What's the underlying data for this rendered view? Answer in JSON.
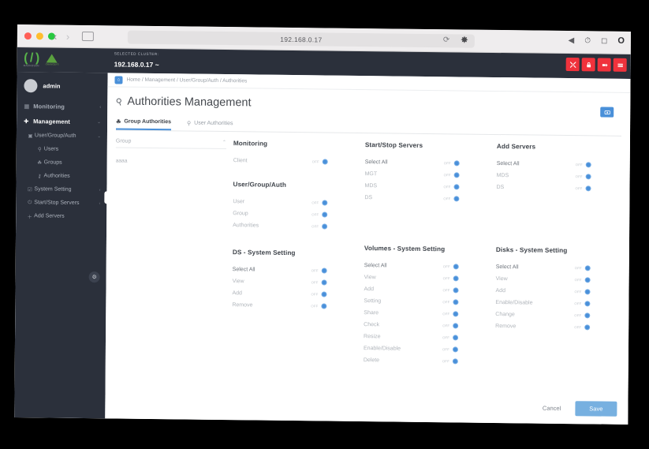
{
  "browser": {
    "url": "192.168.0.17",
    "back_icon": "chevron-left-icon",
    "forward_icon": "chevron-right-icon",
    "sidebar_icon": "sidebar-icon",
    "reload_icon": "reload-icon",
    "share_icon": "share-icon",
    "right_icons": [
      "volume-icon",
      "battery-icon",
      "control-center-icon",
      "clock-icon"
    ]
  },
  "topbar": {
    "cluster_label": "SELECTED CLUSTER:",
    "cluster_value": "192.168.0.17 ~",
    "logo_primary": "( / )",
    "logo_primary_sub": "MACROSAN",
    "logo_secondary_sub": "ORANGEFS",
    "actions": [
      {
        "name": "fullscreen-button",
        "icon": "expand-icon"
      },
      {
        "name": "lock-button",
        "icon": "lock-icon"
      },
      {
        "name": "logout-button",
        "icon": "logout-icon"
      },
      {
        "name": "menu-button",
        "icon": "hamburger-icon"
      }
    ],
    "action_color": "#f0323c"
  },
  "sidebar": {
    "user": "admin",
    "avatar": "avatar-icon",
    "collapse_icon": "chevron-left-icon",
    "items": [
      {
        "label": "Monitoring",
        "icon": "chart-icon",
        "level": 0,
        "active": false,
        "caret": "‹"
      },
      {
        "label": "Management",
        "icon": "wrench-icon",
        "level": 0,
        "active": true,
        "caret": "⌄"
      },
      {
        "label": "User/Group/Auth",
        "icon": "▣",
        "level": 1,
        "active": false,
        "caret": "⌄"
      },
      {
        "label": "Users",
        "icon": "⚲",
        "level": 2,
        "active": false,
        "caret": ""
      },
      {
        "label": "Groups",
        "icon": "☘",
        "level": 2,
        "active": false,
        "caret": ""
      },
      {
        "label": "Authorities",
        "icon": "⚷",
        "level": 2,
        "active": false,
        "caret": ""
      },
      {
        "label": "System Setting",
        "icon": "☑",
        "level": 1,
        "active": false,
        "caret": "‹"
      },
      {
        "label": "Start/Stop Servers",
        "icon": "⏻",
        "level": 1,
        "active": false,
        "caret": "‹"
      },
      {
        "label": "Add Servers",
        "icon": "＋",
        "level": 1,
        "active": false,
        "caret": ""
      }
    ]
  },
  "breadcrumb": {
    "home_icon": "home-icon",
    "text": "Home / Management / User/Group/Auth / Authorities"
  },
  "page": {
    "title": "Authorities Management",
    "title_icon": "key-icon",
    "refresh_icon": "refresh-icon"
  },
  "tabs": [
    {
      "label": "Group Authorities",
      "icon": "☘",
      "active": true
    },
    {
      "label": "User Authorities",
      "icon": "⚲",
      "active": false
    }
  ],
  "group_panel": {
    "select_label": "Group",
    "caret": "⌃",
    "groups": [
      "aaaa"
    ]
  },
  "toggle_state_label": "OFF",
  "permission_blocks": [
    {
      "title": "Monitoring",
      "column": 0,
      "rows": [
        {
          "label": "Client",
          "state": "OFF",
          "strong": false
        }
      ]
    },
    {
      "title": "User/Group/Auth",
      "column": 0,
      "rows": [
        {
          "label": "User",
          "state": "OFF",
          "strong": false
        },
        {
          "label": "Group",
          "state": "OFF",
          "strong": false
        },
        {
          "label": "Authorities",
          "state": "OFF",
          "strong": false
        }
      ]
    },
    {
      "title": "Start/Stop Servers",
      "column": 1,
      "rows": [
        {
          "label": "Select All",
          "state": "OFF",
          "strong": true
        },
        {
          "label": "MGT",
          "state": "OFF",
          "strong": false
        },
        {
          "label": "MDS",
          "state": "OFF",
          "strong": false
        },
        {
          "label": "DS",
          "state": "OFF",
          "strong": false
        }
      ]
    },
    {
      "title": "Add Servers",
      "column": 2,
      "rows": [
        {
          "label": "Select All",
          "state": "OFF",
          "strong": true
        },
        {
          "label": "MDS",
          "state": "OFF",
          "strong": false
        },
        {
          "label": "DS",
          "state": "OFF",
          "strong": false
        }
      ]
    },
    {
      "title": "DS - System Setting",
      "column": 0,
      "rows": [
        {
          "label": "Select All",
          "state": "OFF",
          "strong": true
        },
        {
          "label": "View",
          "state": "OFF",
          "strong": false
        },
        {
          "label": "Add",
          "state": "OFF",
          "strong": false
        },
        {
          "label": "Remove",
          "state": "OFF",
          "strong": false
        }
      ]
    },
    {
      "title": "Volumes - System Setting",
      "column": 1,
      "rows": [
        {
          "label": "Select All",
          "state": "OFF",
          "strong": true
        },
        {
          "label": "View",
          "state": "OFF",
          "strong": false
        },
        {
          "label": "Add",
          "state": "OFF",
          "strong": false
        },
        {
          "label": "Setting",
          "state": "OFF",
          "strong": false
        },
        {
          "label": "Share",
          "state": "OFF",
          "strong": false
        },
        {
          "label": "Check",
          "state": "OFF",
          "strong": false
        },
        {
          "label": "Resize",
          "state": "OFF",
          "strong": false
        },
        {
          "label": "Enable/Disable",
          "state": "OFF",
          "strong": false
        },
        {
          "label": "Delete",
          "state": "OFF",
          "strong": false
        }
      ]
    },
    {
      "title": "Disks - System Setting",
      "column": 2,
      "rows": [
        {
          "label": "Select All",
          "state": "OFF",
          "strong": true
        },
        {
          "label": "View",
          "state": "OFF",
          "strong": false
        },
        {
          "label": "Add",
          "state": "OFF",
          "strong": false
        },
        {
          "label": "Enable/Disable",
          "state": "OFF",
          "strong": false
        },
        {
          "label": "Change",
          "state": "OFF",
          "strong": false
        },
        {
          "label": "Remove",
          "state": "OFF",
          "strong": false
        }
      ]
    }
  ],
  "footer": {
    "cancel_label": "Cancel",
    "save_label": "Save",
    "save_color": "#77b0e0"
  }
}
